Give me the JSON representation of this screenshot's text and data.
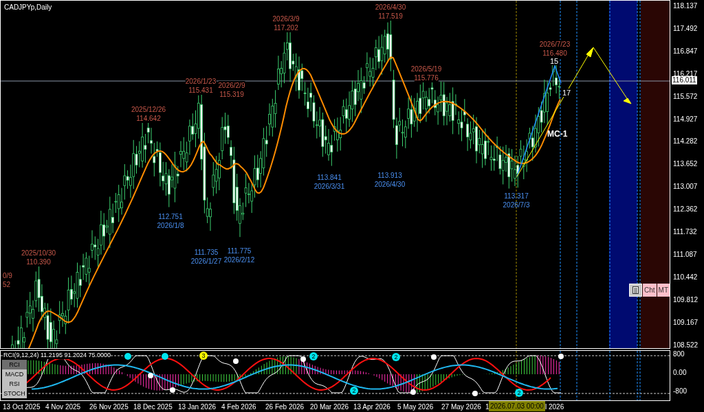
{
  "chart": {
    "title": "CADJPYp,Daily",
    "highs": [
      {
        "date": "0/9",
        "price": "52"
      },
      {
        "date": "2025/10/30",
        "price": "110.390"
      },
      {
        "date": "2025/12/26",
        "price": "114.642"
      },
      {
        "date": "2026/1/23",
        "price": "115.431"
      },
      {
        "date": "2026/2/9",
        "price": "115.319"
      },
      {
        "date": "2026/3/9",
        "price": "117.202"
      },
      {
        "date": "2026/4/30",
        "price": "117.519"
      },
      {
        "date": "2026/5/19",
        "price": "115.776"
      },
      {
        "date": "2026/7/23",
        "price": "116.480"
      }
    ],
    "lows": [
      {
        "price": "112.751",
        "date": "2026/1/8"
      },
      {
        "price": "111.735",
        "date": "2026/1/27"
      },
      {
        "price": "111.775",
        "date": "2026/2/12"
      },
      {
        "price": "113.841",
        "date": "2026/3/31"
      },
      {
        "price": "113.913",
        "date": "2026/4/30"
      },
      {
        "price": "113.317",
        "date": "2026/7/3"
      }
    ],
    "wave_labels": [
      "15",
      "17"
    ],
    "pattern_label": "MC-1",
    "buttons": [
      {
        "kind": "icon"
      },
      {
        "kind": "text",
        "label": "Cht"
      },
      {
        "kind": "text",
        "label": "MT"
      }
    ]
  },
  "price_axis": {
    "ticks": [
      "118.137",
      "117.492",
      "116.847",
      "116.217",
      "115.572",
      "114.927",
      "114.282",
      "113.652",
      "113.007",
      "112.362",
      "111.732",
      "111.087",
      "110.442",
      "109.812",
      "109.167",
      "108.522"
    ],
    "current_price": "116.011"
  },
  "indicator": {
    "legend": "RCI(9,12,24) 11.2195 91.2024 75.0000",
    "tabs": [
      {
        "label": "RCI",
        "selected": true
      },
      {
        "label": "MACD",
        "selected": false
      },
      {
        "label": "RSI",
        "selected": false
      },
      {
        "label": "STOCH",
        "selected": false
      }
    ],
    "markers": [
      {
        "label": "3",
        "color": "#ffff00"
      },
      {
        "label": "2",
        "color": "#00e5ee"
      },
      {
        "label": "2",
        "color": "#00e5ee"
      },
      {
        "label": "2",
        "color": "#00e5ee"
      },
      {
        "label": "2",
        "color": "#00e5ee"
      }
    ],
    "axis": [
      "800",
      "0.00",
      "-800"
    ]
  },
  "time_axis": {
    "labels": [
      "13 Oct 2025",
      "4 Nov 2025",
      "26 Nov 2025",
      "18 Dec 2025",
      "13 Jan 2026",
      "4 Feb 2026",
      "26 Feb 2026",
      "20 Mar 2026",
      "13 Apr 2026",
      "5 May 2026",
      "27 May 2026",
      "1",
      "l 2026"
    ],
    "cursor_label": "2026.07.03 00:00"
  }
}
